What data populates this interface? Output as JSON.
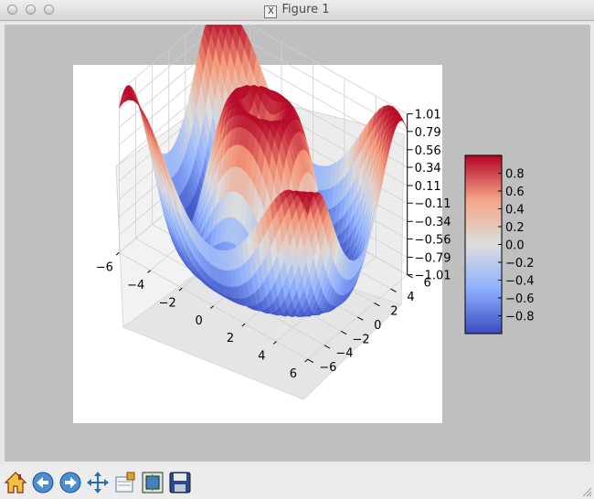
{
  "window": {
    "title": "Figure 1",
    "x_icon": "X"
  },
  "toolbar": {
    "buttons": [
      {
        "name": "home-icon",
        "tooltip": "Reset original view"
      },
      {
        "name": "back-arrow-icon",
        "tooltip": "Back to previous view"
      },
      {
        "name": "forward-arrow-icon",
        "tooltip": "Forward to next view"
      },
      {
        "name": "pan-icon",
        "tooltip": "Pan axes"
      },
      {
        "name": "zoom-icon",
        "tooltip": "Zoom to rectangle"
      },
      {
        "name": "configure-subplots-icon",
        "tooltip": "Configure subplots"
      },
      {
        "name": "save-icon",
        "tooltip": "Save the figure"
      }
    ]
  },
  "chart_data": {
    "type": "surface3d",
    "colormap": "coolwarm",
    "x_ticks": [
      "−6",
      "−4",
      "−2",
      "0",
      "2",
      "4",
      "6"
    ],
    "y_ticks": [
      "−6",
      "−4",
      "−2",
      "0",
      "2",
      "4",
      "6"
    ],
    "z_ticks": [
      "−1.01",
      "−0.79",
      "−0.56",
      "−0.34",
      "−0.11",
      "0.11",
      "0.34",
      "0.56",
      "0.79",
      "1.01"
    ],
    "colorbar_ticks": [
      "0.8",
      "0.6",
      "0.4",
      "0.2",
      "0.0",
      "−0.2",
      "−0.4",
      "−0.6",
      "−0.8"
    ],
    "xlim": [
      -6,
      6
    ],
    "ylim": [
      -6,
      6
    ],
    "zlim": [
      -1.01,
      1.01
    ],
    "grid": true
  }
}
